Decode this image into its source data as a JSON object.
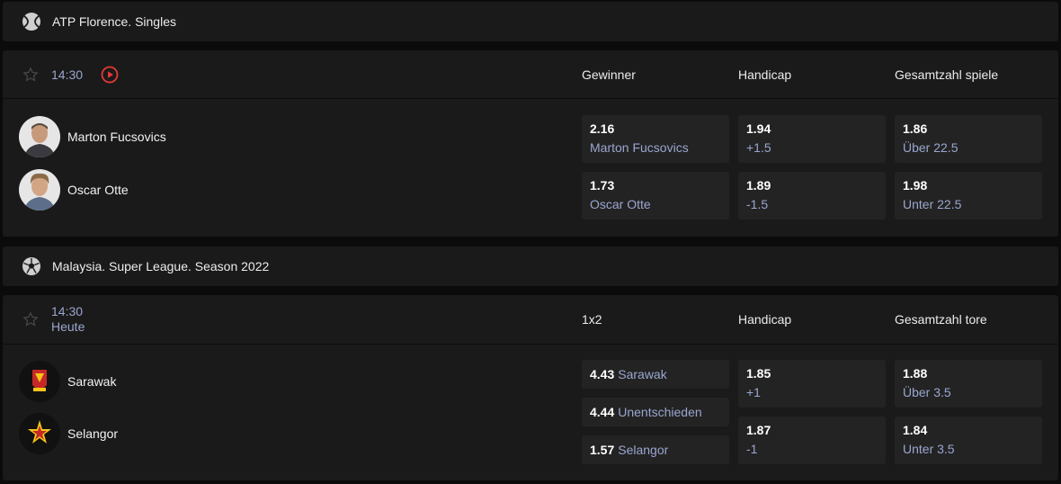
{
  "leagues": [
    {
      "title": "ATP Florence. Singles",
      "icon": "tennis-ball-icon",
      "match": {
        "time": "14:30",
        "day": "",
        "markets": [
          "Gewinner",
          "Handicap",
          "Gesamtzahl spiele"
        ],
        "teams": [
          "Marton Fucsovics",
          "Oscar Otte"
        ],
        "winner": [
          {
            "odd": "2.16",
            "label": "Marton Fucsovics"
          },
          {
            "odd": "1.73",
            "label": "Oscar Otte"
          }
        ],
        "handicap": [
          {
            "odd": "1.94",
            "label": "+1.5"
          },
          {
            "odd": "1.89",
            "label": "-1.5"
          }
        ],
        "total": [
          {
            "odd": "1.86",
            "label": "Über 22.5"
          },
          {
            "odd": "1.98",
            "label": "Unter 22.5"
          }
        ]
      }
    },
    {
      "title": "Malaysia. Super League. Season 2022",
      "icon": "soccer-ball-icon",
      "match": {
        "time": "14:30",
        "day": "Heute",
        "markets": [
          "1x2",
          "Handicap",
          "Gesamtzahl tore"
        ],
        "teams": [
          "Sarawak",
          "Selangor"
        ],
        "winner": [
          {
            "odd": "4.43",
            "label": "Sarawak"
          },
          {
            "odd": "4.44",
            "label": "Unentschieden"
          },
          {
            "odd": "1.57",
            "label": "Selangor"
          }
        ],
        "handicap": [
          {
            "odd": "1.85",
            "label": "+1"
          },
          {
            "odd": "1.87",
            "label": "-1"
          }
        ],
        "total": [
          {
            "odd": "1.88",
            "label": "Über 3.5"
          },
          {
            "odd": "1.84",
            "label": "Unter 3.5"
          }
        ]
      }
    }
  ],
  "colors": {
    "panel": "#1a1a1a",
    "odd_box": "#232323",
    "accent_label": "#9aa6cf",
    "live_red": "#e53935"
  }
}
